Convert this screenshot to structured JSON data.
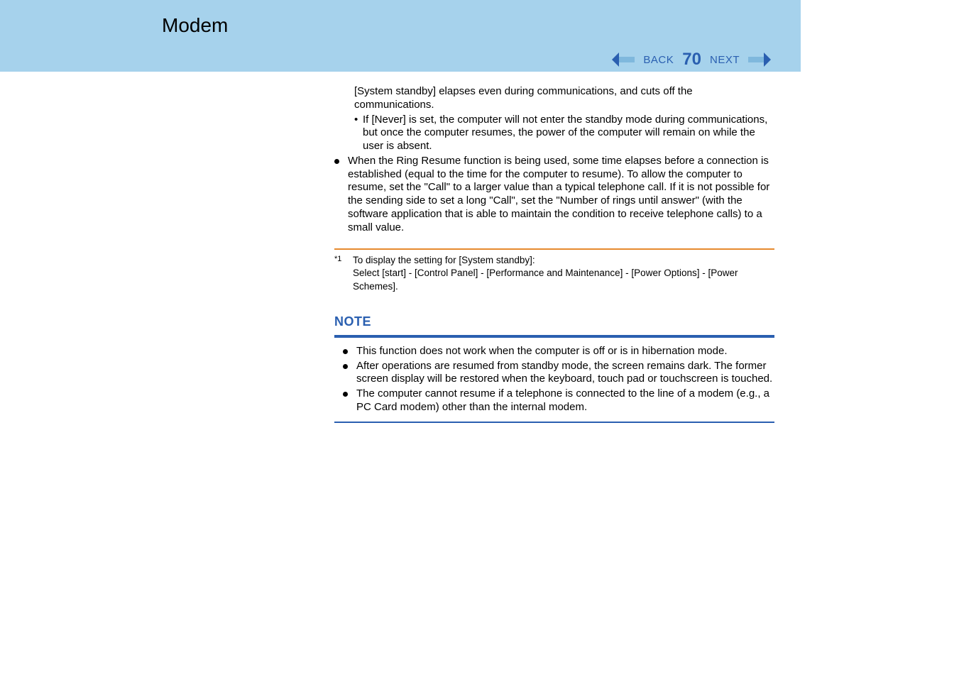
{
  "header": {
    "title": "Modem"
  },
  "nav": {
    "back_label": "BACK",
    "page_number": "70",
    "next_label": "NEXT"
  },
  "content": {
    "para1": "[System standby] elapses even during communications, and cuts off the communications.",
    "sub_dash": "•",
    "sub1": "If [Never] is set, the computer will not enter the standby mode during communications, but once the computer resumes, the power of the computer will remain on while the user is absent.",
    "bullet1": "When the Ring Resume function is being used, some time elapses before a connection is established (equal to the time for the computer to resume).  To allow the computer to resume, set the \"Call\" to a larger value than a typical telephone call. If it is not possible for the sending side to set a long \"Call\", set the \"Number of rings until answer\" (with the software application that is able to maintain the condition to receive telephone calls) to a small value."
  },
  "footnote": {
    "marker": "*1",
    "line1": "To display the setting for [System standby]:",
    "line2": "Select [start] - [Control Panel] - [Performance and Maintenance] - [Power Options] - [Power Schemes]."
  },
  "note": {
    "heading": "NOTE",
    "item1": "This function does not work when the computer is off or is in hibernation mode.",
    "item2": "After operations are resumed from standby mode, the screen remains dark.  The former screen display will be restored when the keyboard, touch pad or touchscreen is touched.",
    "item3": "The computer cannot resume if a telephone is connected to the line of a modem (e.g., a PC Card modem) other than the internal modem."
  }
}
